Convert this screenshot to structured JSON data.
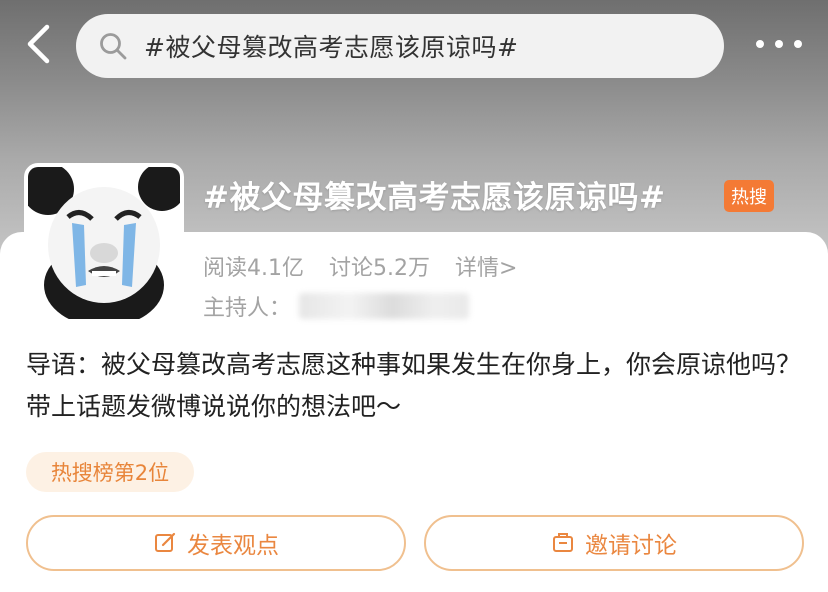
{
  "header": {
    "search_text": "#被父母篡改高考志愿该原谅吗#"
  },
  "topic": {
    "title": "#被父母篡改高考志愿该原谅吗#",
    "badge": "热搜",
    "reads": "阅读4.1亿",
    "discussions": "讨论5.2万",
    "details": "详情>",
    "host_label": "主持人："
  },
  "intro": "导语：被父母篡改高考志愿这种事如果发生在你身上，你会原谅他吗？带上话题发微博说说你的想法吧～",
  "rank_tag": "热搜榜第2位",
  "actions": {
    "post": "发表观点",
    "invite": "邀请讨论"
  },
  "colors": {
    "accent": "#ea8740",
    "badge": "#f47a35",
    "rank_bg": "#fdf1e4"
  },
  "icons": {
    "back": "back-arrow-icon",
    "search": "search-icon",
    "more": "more-dots-icon",
    "post": "edit-icon",
    "invite": "invite-icon"
  }
}
